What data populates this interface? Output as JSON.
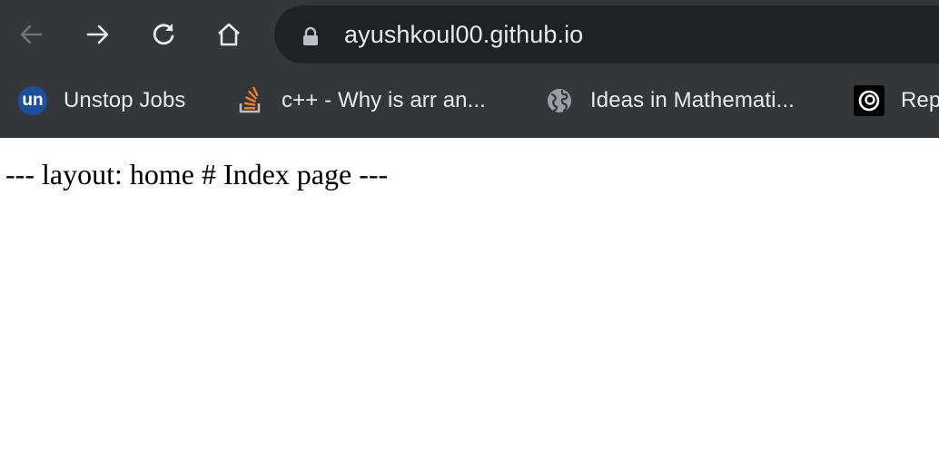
{
  "browser": {
    "address_bar": {
      "url": "ayushkoul00.github.io",
      "icon": "lock-icon"
    },
    "nav": {
      "back_icon": "arrow-left-icon",
      "forward_icon": "arrow-right-icon",
      "reload_icon": "reload-icon",
      "home_icon": "home-icon"
    },
    "bookmarks": [
      {
        "label": "Unstop Jobs",
        "icon_text": "un",
        "icon": "unstop-icon"
      },
      {
        "label": "c++ - Why is arr an...",
        "icon": "stackoverflow-icon"
      },
      {
        "label": "Ideas in Mathemati...",
        "icon": "globe-icon"
      },
      {
        "label": "Rep",
        "icon": "replit-icon"
      }
    ]
  },
  "page": {
    "text": "--- layout: home # Index page ---"
  },
  "colors": {
    "chrome_bg": "#35363a",
    "omnibox_bg": "#202124",
    "text_light": "#e8eaed",
    "page_bg": "#ffffff",
    "stackoverflow_orange": "#f48024"
  }
}
